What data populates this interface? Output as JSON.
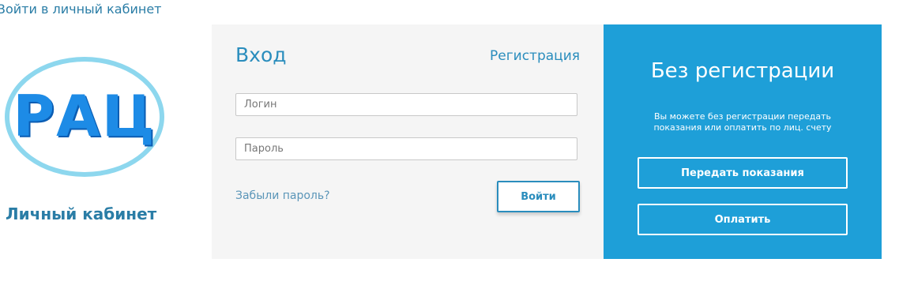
{
  "page": {
    "heading": "Войти в личный кабинет"
  },
  "logo": {
    "text": "РАЦ",
    "caption": "Личный кабинет",
    "colors": {
      "ring": "#8dd7ee",
      "letters": "#1d8be6"
    }
  },
  "login": {
    "title": "Вход",
    "register_link": "Регистрация",
    "login_placeholder": "Логин",
    "password_placeholder": "Пароль",
    "forgot_link": "Забыли пароль?",
    "submit_label": "Войти"
  },
  "guest": {
    "title": "Без регистрации",
    "description": "Вы можете без регистрации передать показания или оплатить по лиц. счету",
    "submit_readings_label": "Передать показания",
    "pay_label": "Оплатить"
  },
  "colors": {
    "accent": "#2a8dbd",
    "panel_blue": "#1e9fd8",
    "panel_gray": "#f5f5f5"
  }
}
